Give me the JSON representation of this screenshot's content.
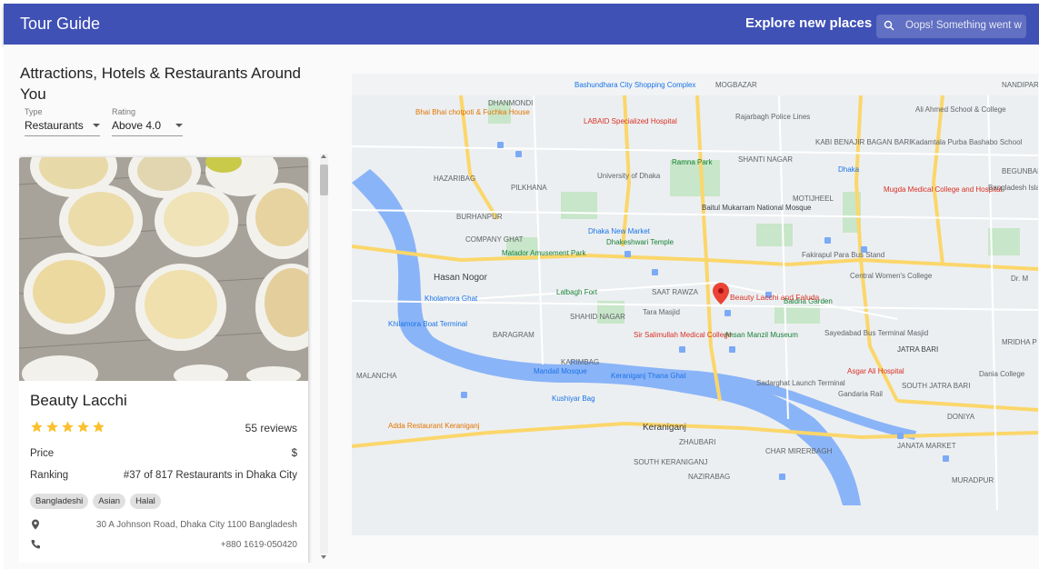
{
  "app": {
    "title": "Tour Guide",
    "explore_label": "Explore new places",
    "search_error": "Oops! Something went w"
  },
  "sidebar": {
    "heading": "Attractions, Hotels & Restaurants Around You",
    "type_filter": {
      "label": "Type",
      "value": "Restaurants"
    },
    "rating_filter": {
      "label": "Rating",
      "value": "Above 4.0"
    }
  },
  "place": {
    "name": "Beauty Lacchi",
    "rating": 5,
    "reviews": "55 reviews",
    "price_label": "Price",
    "price_value": "$",
    "ranking_label": "Ranking",
    "ranking_value": "#37 of 817 Restaurants in Dhaka City",
    "cuisines": [
      "Bangladeshi",
      "Asian",
      "Halal"
    ],
    "address": "30 A Johnson Road, Dhaka City 1100 Bangladesh",
    "phone": "+880 1619-050420"
  },
  "map": {
    "marker_label": "Beauty Lacchi and Faluda",
    "labels": [
      "DHANMONDI",
      "MOGBAZAR",
      "Rajarbagh Police Lines",
      "KABI BENAJIR BAGAN BARI",
      "SHANTI NAGAR",
      "Ramna Park",
      "Baitul Mukarram National Mosque",
      "University of Dhaka",
      "Dhaka New Market",
      "PILKHANA",
      "HAZARIBAG",
      "BURHANPUR",
      "COMPANY GHAT",
      "Matador Amusement Park",
      "Dhakeshwari Temple",
      "Hasan Nogor",
      "Lalbagh Fort",
      "SAAT RAWZA",
      "SHAHID NAGAR",
      "Tara Masjid",
      "BARAGRAM",
      "KARIMBAG",
      "Sir Salimullah Medical College",
      "Ahsan Manzil Museum",
      "Baldha Garden",
      "Central Women's College",
      "Fakirapul Para Bus Stand",
      "Sayedabad Bus Terminal Masjid",
      "JATRA BARI",
      "Asgar Ali Hospital",
      "Sadarghat Launch Terminal",
      "Gandaria Rail",
      "SOUTH JATRA BARI",
      "DONIYA",
      "Dania College",
      "JANATA MARKET",
      "Keraniganj",
      "ZHAUBARI",
      "CHAR MIRERBAGH",
      "SOUTH KERANIGANJ",
      "NAZIRABAG",
      "MALANCHA",
      "Adda Restaurant Keraniganj",
      "Bhai Bhai chotpoti & Fuchka House",
      "LABAID Specialized Hospital",
      "Mugda Medical College and Hospital",
      "Ali Ahmed School & College",
      "Kadamtala Purba Bashabo School",
      "BEGUNBARI",
      "Bangladesh Islamic University",
      "NANDIPARA",
      "Dhaka",
      "MOTIJHEEL",
      "Bashundhara City Shopping Complex",
      "Kholamora Ghat",
      "Khilamora Boat Terminal",
      "Mandail Mosque",
      "Keraniganj Thana Ghat",
      "Kushiyar Bag",
      "MURADPUR",
      "Dr. M",
      "MRIDHA P"
    ]
  },
  "colors": {
    "appbar": "#3f51b5",
    "star": "#fbc02d",
    "marker": "#ea4335",
    "river": "#8ab4f8",
    "park": "#c8e6c9"
  }
}
